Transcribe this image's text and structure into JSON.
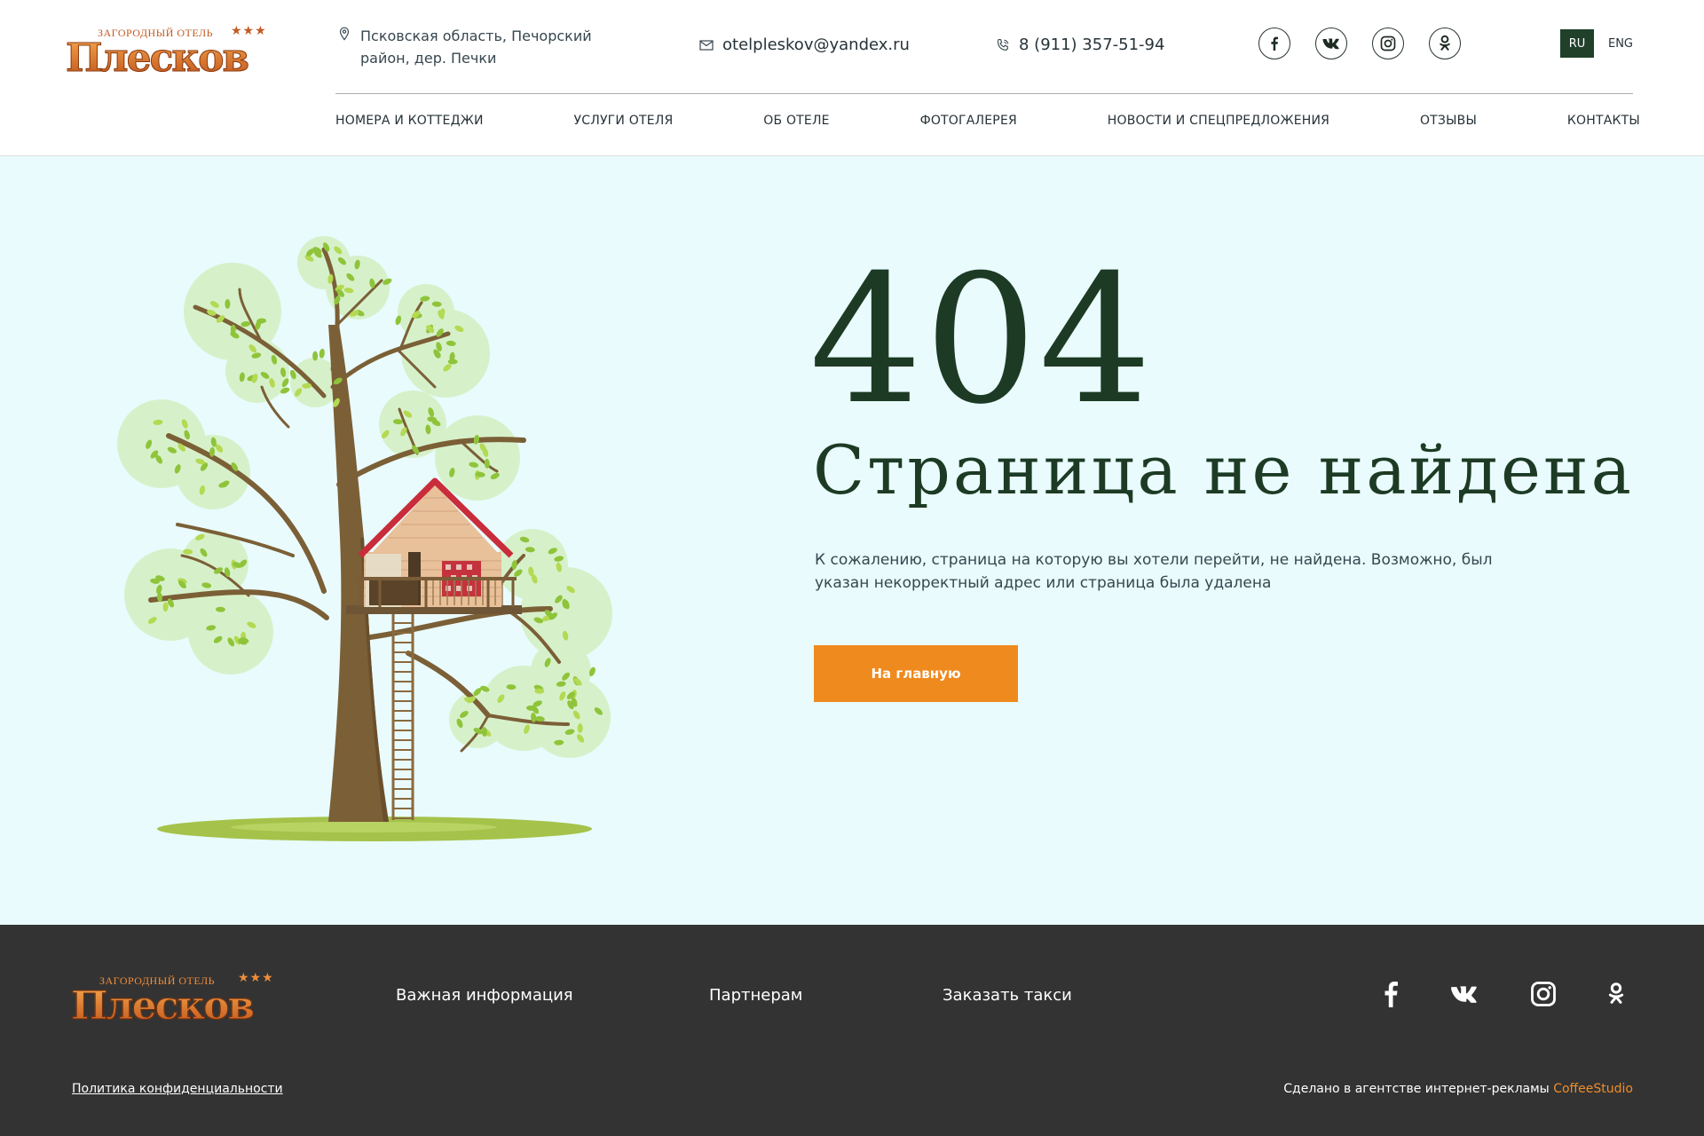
{
  "brand": {
    "tagline": "ЗАГОРОДНЫЙ ОТЕЛЬ",
    "stars": "★★★",
    "name": "Плесков"
  },
  "header": {
    "address_line1": "Псковская область, Печорский",
    "address_line2": "район, дер. Печки",
    "email": "otelpleskov@yandex.ru",
    "phone": "8 (911) 357-51-94",
    "lang_ru": "RU",
    "lang_en": "ENG"
  },
  "nav": [
    "НОМЕРА И КОТТЕДЖИ",
    "УСЛУГИ ОТЕЛЯ",
    "ОБ ОТЕЛЕ",
    "ФОТОГАЛЕРЕЯ",
    "НОВОСТИ И СПЕЦПРЕДЛОЖЕНИЯ",
    "ОТЗЫВЫ",
    "КОНТАКТЫ"
  ],
  "error": {
    "code": "404",
    "title": "Страница не найдена",
    "text": "К сожалению, страница на которую вы хотели перейти, не найдена. Возможно, был указан некорректный адрес или страница была удалена",
    "button": "На главную"
  },
  "footer": {
    "links": [
      "Важная информация",
      "Партнерам",
      "Заказать такси"
    ],
    "privacy": "Политика конфиденциальности",
    "credit_text": "Сделано в агентстве интернет-рекламы ",
    "credit_brand": "CoffeeStudio"
  },
  "colors": {
    "dark_green": "#1d3b24",
    "accent_orange": "#ef8a1e",
    "main_bg": "#e9fbfd",
    "footer_bg": "#333333"
  }
}
